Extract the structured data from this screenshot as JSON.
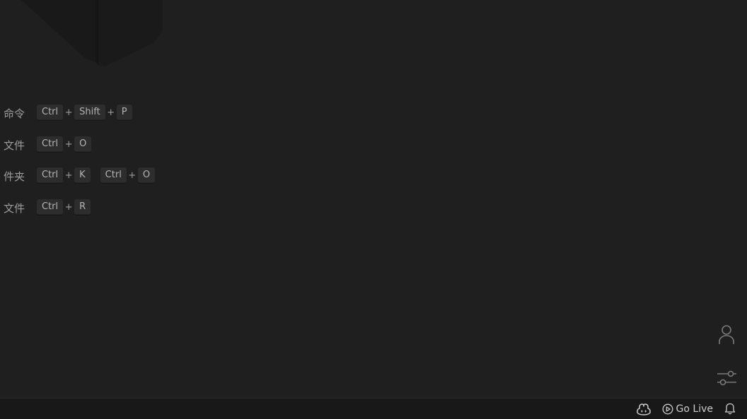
{
  "shortcuts": [
    {
      "label": "命令",
      "combos": [
        [
          "Ctrl",
          "Shift",
          "P"
        ]
      ]
    },
    {
      "label": "文件",
      "combos": [
        [
          "Ctrl",
          "O"
        ]
      ]
    },
    {
      "label": "件夹",
      "combos": [
        [
          "Ctrl",
          "K"
        ],
        [
          "Ctrl",
          "O"
        ]
      ]
    },
    {
      "label": "文件",
      "combos": [
        [
          "Ctrl",
          "R"
        ]
      ]
    }
  ],
  "plus_symbol": "+",
  "icons": {
    "accounts": "account-icon",
    "manage": "settings-sliders-icon",
    "copilot": "copilot-icon",
    "golive": "broadcast-icon",
    "notifications": "bell-icon"
  },
  "statusbar": {
    "golive_label": "Go Live"
  },
  "colors": {
    "editor_bg": "#1f1f1f",
    "statusbar_bg": "#181818",
    "key_bg": "#2d2d2d",
    "text": "#9d9d9d"
  }
}
